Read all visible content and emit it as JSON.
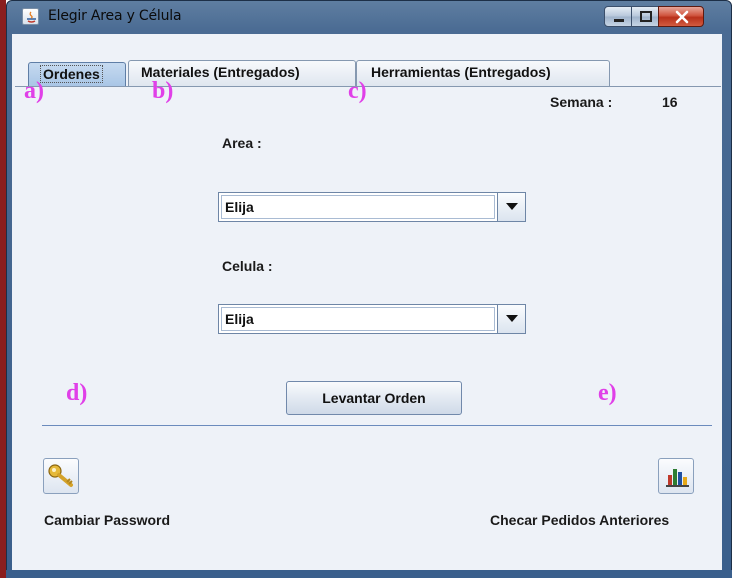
{
  "window": {
    "title": "Elegir Area y Célula",
    "controls": {
      "minimize_icon": "minimize-icon",
      "maximize_icon": "maximize-icon",
      "close_icon": "close-icon"
    }
  },
  "tabs": [
    {
      "label": "Ordenes",
      "selected": true
    },
    {
      "label": "Materiales (Entregados)",
      "selected": false
    },
    {
      "label": "Herramientas (Entregados)",
      "selected": false
    }
  ],
  "annotations": {
    "a": "a)",
    "b": "b)",
    "c": "c)",
    "d": "d)",
    "e": "e)"
  },
  "week": {
    "label": "Semana :",
    "value": "16"
  },
  "area": {
    "label": "Area :",
    "selected": "Elija"
  },
  "celula": {
    "label": "Celula :",
    "selected": "Elija"
  },
  "actions": {
    "levantar_label": "Levantar Orden",
    "cambiar_password_label": "Cambiar Password",
    "checar_pedidos_label": "Checar Pedidos Anteriores"
  },
  "colors": {
    "annotation": "#e040e8",
    "separator": "#6b8bbd",
    "client_bg": "#eef2f8"
  }
}
